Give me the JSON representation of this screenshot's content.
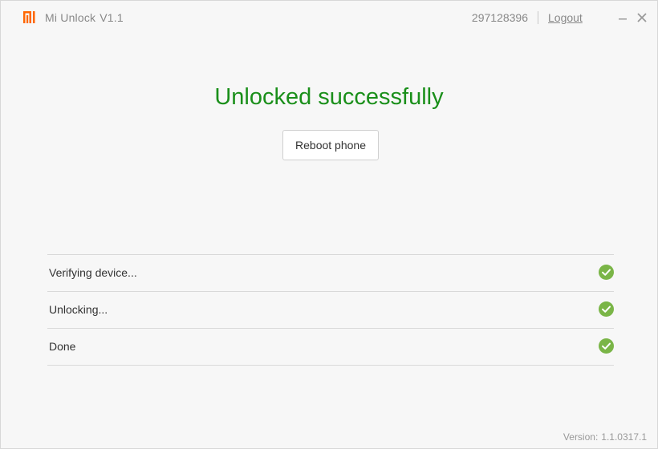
{
  "app": {
    "name": "Mi Unlock",
    "version_badge": "V1.1",
    "brand_color": "#ff6700"
  },
  "account": {
    "user_id": "297128396",
    "logout_label": "Logout"
  },
  "window_controls": {
    "minimize_icon": "minimize-icon",
    "close_icon": "close-icon"
  },
  "main": {
    "headline": "Unlocked successfully",
    "headline_color": "#1a8f1a",
    "reboot_label": "Reboot phone"
  },
  "steps": [
    {
      "label": "Verifying device...",
      "status": "check-circle-icon"
    },
    {
      "label": "Unlocking...",
      "status": "check-circle-icon"
    },
    {
      "label": "Done",
      "status": "check-circle-icon"
    }
  ],
  "status_color": "#7ab547",
  "footer": {
    "version_label": "Version:",
    "version_value": "1.1.0317.1"
  }
}
